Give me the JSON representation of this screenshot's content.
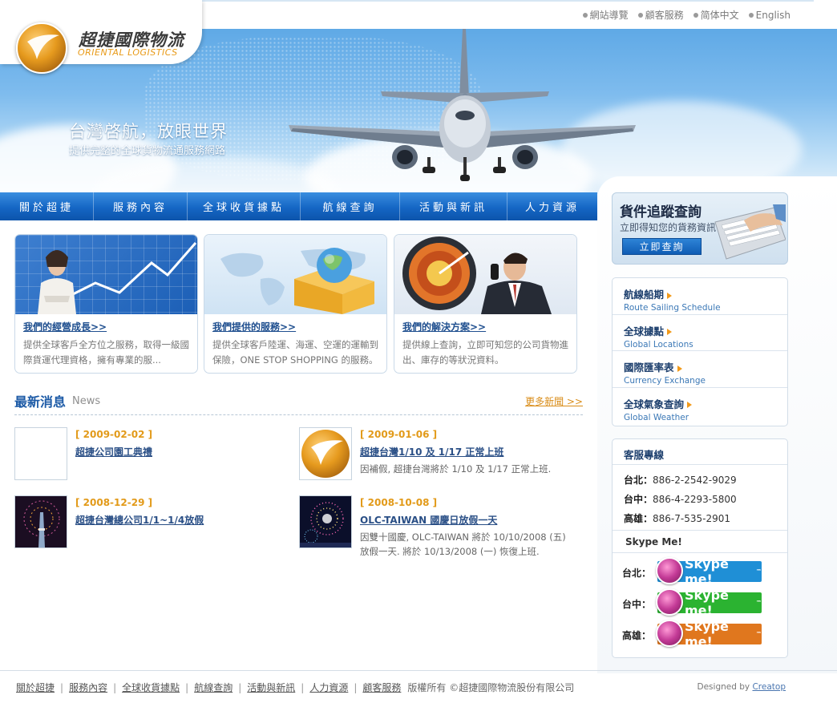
{
  "top_links": [
    "網站導覽",
    "顧客服務",
    "简体中文",
    "English"
  ],
  "logo": {
    "cn": "超捷國際物流",
    "en": "ORIENTAL LOGISTICS"
  },
  "hero": {
    "title": "台灣啓航，放眼世界",
    "subtitle": "提供完整的全球貨物流通服務網路"
  },
  "nav": [
    "關於超捷",
    "服務內容",
    "全球收貨據點",
    "航線查詢",
    "活動與新訊",
    "人力資源"
  ],
  "cards": [
    {
      "title": "我們的經營成長>>",
      "desc": "提供全球客戶全方位之服務，取得一級國際貨運代理資格，擁有專業的服..."
    },
    {
      "title": "我們提供的服務>>",
      "desc": "提供全球客戶陸運、海運、空運的運輸到保險，ONE STOP SHOPPING 的服務。"
    },
    {
      "title": "我們的解決方案>>",
      "desc": "提供線上查詢，立即可知您的公司貨物進出、庫存的等狀況資料。"
    }
  ],
  "news": {
    "title": "最新消息",
    "title_en": "News",
    "more": "更多新聞 >>",
    "items": [
      {
        "date": "[ 2009-02-02 ]",
        "title": "超捷公司園工典禮",
        "desc": ""
      },
      {
        "date": "[ 2009-01-06 ]",
        "title": "超捷台灣1/10 及 1/17 正常上班",
        "desc": "因補假, 超捷台灣將於 1/10 及 1/17 正常上班."
      },
      {
        "date": "[ 2008-12-29 ]",
        "title": "超捷台灣總公司1/1~1/4放假",
        "desc": ""
      },
      {
        "date": "[ 2008-10-08 ]",
        "title": "OLC-TAIWAN 國慶日放假一天",
        "desc": "因雙十國慶, OLC-TAIWAN 將於 10/10/2008 (五) 放假一天. 將於 10/13/2008 (一) 恢復上班."
      }
    ]
  },
  "tracking": {
    "title": "貨件追蹤查詢",
    "subtitle": "立即得知您的貨務資訊",
    "button": "立即查詢"
  },
  "quick_links": [
    {
      "cn": "航線船期",
      "en": "Route Sailing Schedule"
    },
    {
      "cn": "全球據點",
      "en": "Global Locations"
    },
    {
      "cn": "國際匯率表",
      "en": "Currency Exchange"
    },
    {
      "cn": "全球氣象查詢",
      "en": "Global Weather"
    }
  ],
  "service": {
    "title": "客服專線",
    "phones": [
      {
        "city": "台北：",
        "number": "886-2-2542-9029"
      },
      {
        "city": "台中：",
        "number": "886-4-2293-5800"
      },
      {
        "city": "高雄：",
        "number": "886-7-535-2901"
      }
    ],
    "skype_title": "Skype Me!",
    "skype": [
      {
        "city": "台北：",
        "label": "Skype me!",
        "tm": "™",
        "color": "#1f8fd6"
      },
      {
        "city": "台中：",
        "label": "Skype me!",
        "tm": "™",
        "color": "#2bb331"
      },
      {
        "city": "高雄：",
        "label": "Skype me!",
        "tm": "™",
        "color": "#e0771e"
      }
    ]
  },
  "footer": {
    "links": [
      "關於超捷",
      "服務內容",
      "全球收貨據點",
      "航線查詢",
      "活動與新訊",
      "人力資源",
      "顧客服務"
    ],
    "copyright": "版權所有 ©超捷國際物流股份有限公司",
    "credit_prefix": "Designed by",
    "credit_name": "Creatop"
  },
  "colors": {
    "nav": "#1566c4",
    "accent": "#e29a19",
    "link": "#2a4f86"
  }
}
